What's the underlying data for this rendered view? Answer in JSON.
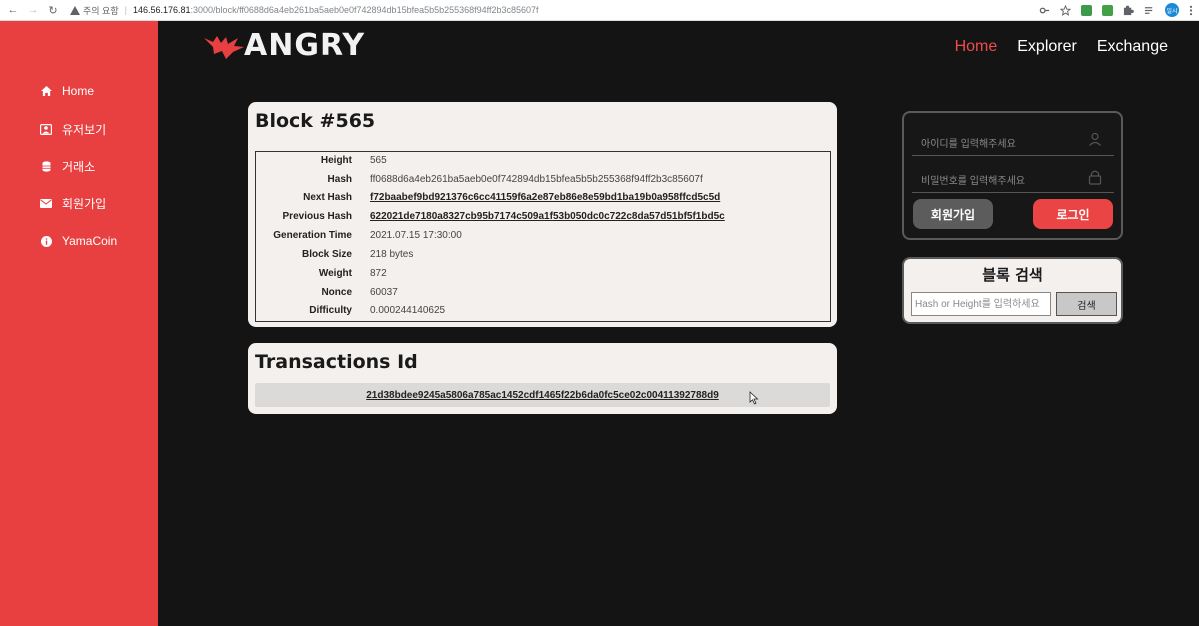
{
  "browser": {
    "security_label": "주의 요함",
    "url_host": "146.56.176.81",
    "url_path": ":3000/block/ff0688d6a4eb261ba5aeb0e0f742894db15bfea5b5b255368f94ff2b3c85607f",
    "profile_label": "일시"
  },
  "logo": {
    "text": "ANGRY"
  },
  "topnav": {
    "home": "Home",
    "explorer": "Explorer",
    "exchange": "Exchange"
  },
  "sidebar": {
    "items": [
      {
        "label": "Home",
        "icon": "home-icon"
      },
      {
        "label": "유저보기",
        "icon": "user-icon"
      },
      {
        "label": "거래소",
        "icon": "database-icon"
      },
      {
        "label": "회원가입",
        "icon": "envelope-icon"
      },
      {
        "label": "YamaCoin",
        "icon": "info-icon"
      }
    ]
  },
  "block": {
    "title": "Block #565",
    "rows": [
      {
        "key": "Height",
        "value": "565"
      },
      {
        "key": "Hash",
        "value": "ff0688d6a4eb261ba5aeb0e0f742894db15bfea5b5b255368f94ff2b3c85607f"
      },
      {
        "key": "Next Hash",
        "value": "f72baabef9bd921376c6cc41159f6a2e87eb86e8e59bd1ba19b0a958ffcd5c5d"
      },
      {
        "key": "Previous Hash",
        "value": "622021de7180a8327cb95b7174c509a1f53b050dc0c722c8da57d51bf5f1bd5c"
      },
      {
        "key": "Generation Time",
        "value": "2021.07.15 17:30:00"
      },
      {
        "key": "Block Size",
        "value": "218 bytes"
      },
      {
        "key": "Weight",
        "value": "872"
      },
      {
        "key": "Nonce",
        "value": "60037"
      },
      {
        "key": "Difficulty",
        "value": "0.000244140625"
      }
    ]
  },
  "transactions": {
    "title": "Transactions Id",
    "ids": [
      "21d38bdee9245a5806a785ac1452cdf1465f22b6da0fc5ce02c00411392788d9"
    ]
  },
  "login": {
    "id_placeholder": "아이디를 입력해주세요",
    "pw_placeholder": "비밀번호를 입력해주세요",
    "signup_label": "회원가입",
    "login_label": "로그인",
    "signup_color": "#5c5c5c",
    "login_color": "#ea4444"
  },
  "search": {
    "title": "블록 검색",
    "placeholder": "Hash or Height를 입력하세요",
    "button_label": "검색"
  },
  "colors": {
    "accent": "#e84040",
    "background": "#141414",
    "card": "#f4f0ee"
  }
}
